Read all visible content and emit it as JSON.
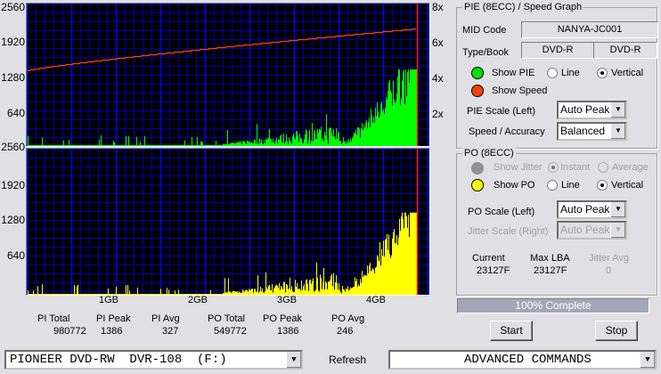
{
  "charts": {
    "pie_axis_left": [
      "2560",
      "1920",
      "1280",
      "640"
    ],
    "po_axis_left": [
      "2560",
      "1920",
      "1280",
      "640"
    ],
    "speed_axis_right": [
      "8x",
      "6x",
      "4x",
      "2x"
    ],
    "x_axis": [
      "1GB",
      "2GB",
      "3GB",
      "4GB"
    ],
    "colors": {
      "background": "#000000",
      "grid": "#0000a0",
      "major_grid": "#0000ff",
      "pie": "#00ff00",
      "po": "#ffff00",
      "speed": "#ff4000",
      "end_marker": "#ff2000"
    }
  },
  "stats": [
    {
      "label": "PI Total",
      "value": "980772"
    },
    {
      "label": "PI Peak",
      "value": "1386"
    },
    {
      "label": "PI Avg",
      "value": "327"
    },
    {
      "label": "PO Total",
      "value": "549772"
    },
    {
      "label": "PO Peak",
      "value": "1386"
    },
    {
      "label": "PO Avg",
      "value": "246"
    }
  ],
  "pie_group": {
    "title": "PIE (8ECC) / Speed Graph",
    "mid_label": "MID Code",
    "mid_value": "NANYA-JC001",
    "type_label": "Type/Book",
    "type_value": "DVD-R",
    "book_value": "DVD-R",
    "show_pie": "Show PIE",
    "line": "Line",
    "vertical": "Vertical",
    "show_speed": "Show Speed",
    "scale_label": "PIE Scale (Left)",
    "scale_value": "Auto Peak",
    "accuracy_label": "Speed / Accuracy",
    "accuracy_value": "Balanced",
    "selected_mode": "Vertical"
  },
  "po_group": {
    "title": "PO (8ECC)",
    "show_jitter": "Show Jitter",
    "instant": "Instant",
    "average": "Average",
    "show_po": "Show PO",
    "line": "Line",
    "vertical": "Vertical",
    "scale_label": "PO Scale (Left)",
    "scale_value": "Auto Peak",
    "jitter_scale_label": "Jitter Scale (Right)",
    "jitter_scale_value": "Auto Peak",
    "current_label": "Current",
    "current_value": "23127F",
    "maxlba_label": "Max LBA",
    "maxlba_value": "23127F",
    "jitter_avg_label": "Jitter Avg",
    "jitter_avg_value": "0",
    "selected_mode": "Vertical"
  },
  "progress": {
    "text": "100% Complete",
    "percent": 100
  },
  "buttons": {
    "start": "Start",
    "stop": "Stop",
    "refresh": "Refresh"
  },
  "drive": {
    "value": "PIONEER DVD-RW  DVR-108  (F:)"
  },
  "advanced": {
    "value": "ADVANCED COMMANDS"
  }
}
